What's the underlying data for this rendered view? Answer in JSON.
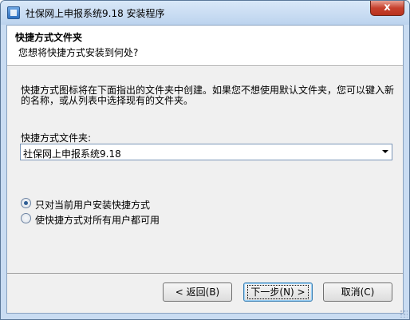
{
  "window": {
    "title": "社保网上申报系统9.18 安装程序",
    "close_label": "x"
  },
  "header": {
    "title": "快捷方式文件夹",
    "subtitle": "您想将快捷方式安装到何处?"
  },
  "body": {
    "description": "快捷方式图标将在下面指出的文件夹中创建。如果您不想使用默认文件夹，您可以键入新的名称，或从列表中选择现有的文件夹。",
    "folder_label": "快捷方式文件夹:",
    "folder_value": "社保网上申报系统9.18"
  },
  "options": [
    {
      "label": "只对当前用户安装快捷方式",
      "checked": true
    },
    {
      "label": "使快捷方式对所有用户都可用",
      "checked": false
    }
  ],
  "buttons": {
    "back": "< 返回(B)",
    "next": "下一步(N) >",
    "cancel": "取消(C)"
  }
}
